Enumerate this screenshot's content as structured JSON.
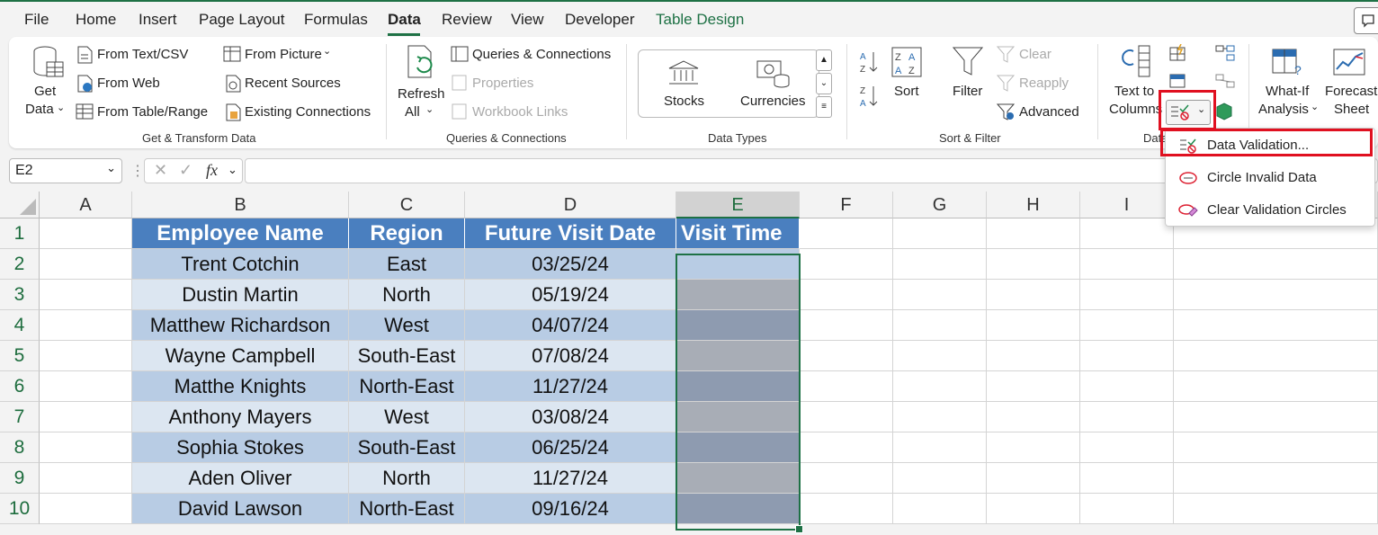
{
  "menu": {
    "items": [
      "File",
      "Home",
      "Insert",
      "Page Layout",
      "Formulas",
      "Data",
      "Review",
      "View",
      "Developer",
      "Table Design"
    ],
    "active": "Data"
  },
  "ribbon": {
    "get_data": {
      "line1": "Get",
      "line2": "Data"
    },
    "from_text_csv": "From Text/CSV",
    "from_web": "From Web",
    "from_table_range": "From Table/Range",
    "from_picture": "From Picture",
    "recent_sources": "Recent Sources",
    "existing_connections": "Existing Connections",
    "group_get_transform": "Get & Transform Data",
    "refresh_all": {
      "line1": "Refresh",
      "line2": "All"
    },
    "queries_connections": "Queries & Connections",
    "properties": "Properties",
    "workbook_links": "Workbook Links",
    "group_queries": "Queries & Connections",
    "stocks": "Stocks",
    "currencies": "Currencies",
    "group_data_types": "Data Types",
    "sort": "Sort",
    "filter": "Filter",
    "clear": "Clear",
    "reapply": "Reapply",
    "advanced": "Advanced",
    "group_sort_filter": "Sort & Filter",
    "text_to_columns": {
      "line1": "Text to",
      "line2": "Columns"
    },
    "group_data_tools": "Data",
    "what_if": {
      "line1": "What-If",
      "line2": "Analysis"
    },
    "forecast": {
      "line1": "Forecast",
      "line2": "Sheet"
    }
  },
  "formula_bar": {
    "name_box": "E2",
    "fx": "fx",
    "value": ""
  },
  "columns": [
    "A",
    "B",
    "C",
    "D",
    "E",
    "F",
    "G",
    "H",
    "I"
  ],
  "rows": [
    "1",
    "2",
    "3",
    "4",
    "5",
    "6",
    "7",
    "8",
    "9",
    "10"
  ],
  "table": {
    "headers": [
      "Employee Name",
      "Region",
      "Future Visit Date",
      "Visit Time"
    ],
    "rows": [
      [
        "Trent Cotchin",
        "East",
        "03/25/24",
        ""
      ],
      [
        "Dustin Martin",
        "North",
        "05/19/24",
        ""
      ],
      [
        "Matthew Richardson",
        "West",
        "04/07/24",
        ""
      ],
      [
        "Wayne Campbell",
        "South-East",
        "07/08/24",
        ""
      ],
      [
        "Matthe Knights",
        "North-East",
        "11/27/24",
        ""
      ],
      [
        "Anthony Mayers",
        "West",
        "03/08/24",
        ""
      ],
      [
        "Sophia Stokes",
        "South-East",
        "06/25/24",
        ""
      ],
      [
        "Aden Oliver",
        "North",
        "11/27/24",
        ""
      ],
      [
        "David Lawson",
        "North-East",
        "09/16/24",
        ""
      ]
    ]
  },
  "dropdown": {
    "items": [
      "Data Validation...",
      "Circle Invalid Data",
      "Clear Validation Circles"
    ]
  },
  "colors": {
    "accent": "#1e7145",
    "table_header": "#4a7fbf",
    "highlight": "#e01020"
  }
}
